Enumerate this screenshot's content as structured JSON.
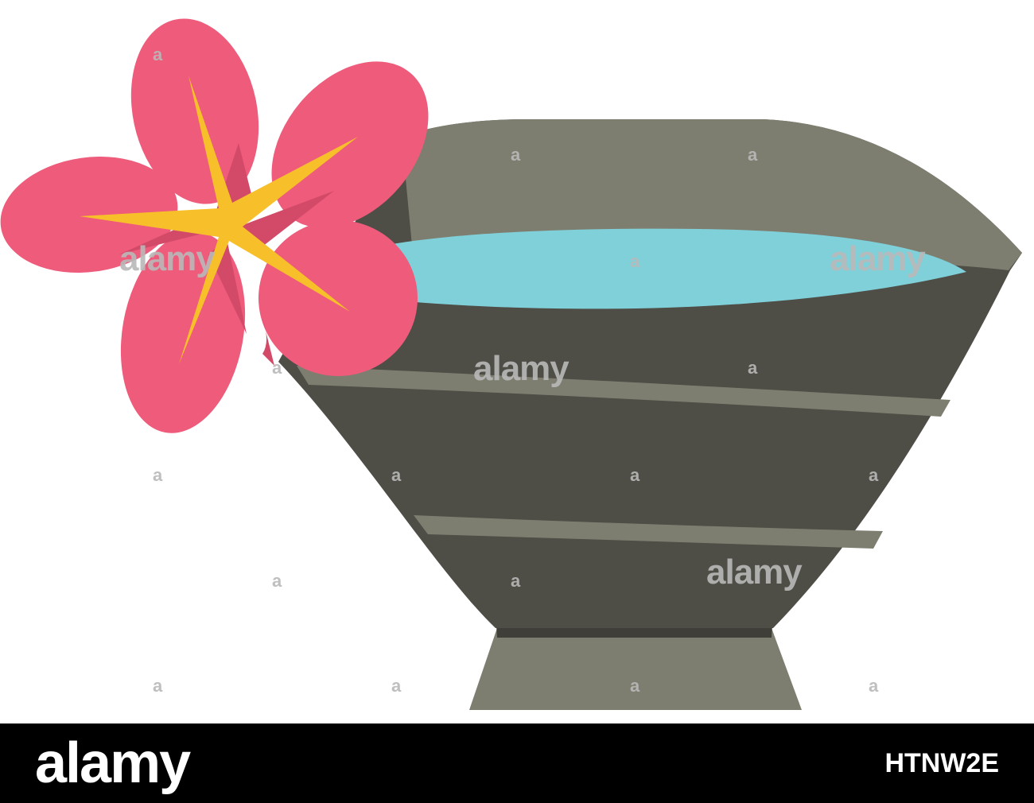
{
  "image": {
    "subject": "bowl-of-water-with-pink-flower",
    "icons": [
      "bowl-icon",
      "water-surface-icon",
      "flower-icon"
    ],
    "colors": {
      "background": "#ffffff",
      "bowl_dark": "#4e4d46",
      "bowl_light": "#7e7e70",
      "bowl_foot_shadow": "#3f3e38",
      "water": "#80d0da",
      "petal": "#ee5b7b",
      "petal_shadow": "#d34a68",
      "stamen": "#f7c02a",
      "watermark": "#b9b9b9",
      "footer_bg": "#000000",
      "footer_text": "#ffffff"
    },
    "watermark": {
      "word": "alamy",
      "mark": "a"
    }
  },
  "footer": {
    "brand": "alamy",
    "image_id": "HTNW2E"
  }
}
